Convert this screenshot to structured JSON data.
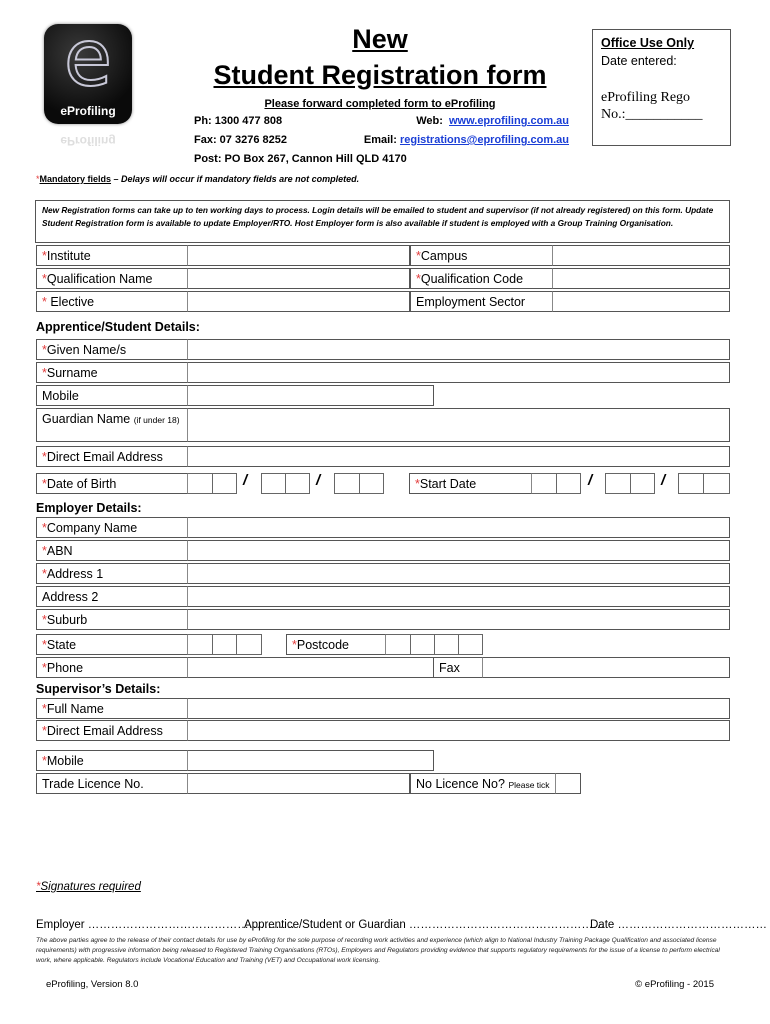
{
  "header": {
    "logo_text": "eProfiling",
    "title_line1": "New",
    "title_line2": "Student Registration form",
    "subtitle": "Please forward completed form to eProfiling",
    "phone": "Ph: 1300 477 808",
    "fax": "Fax: 07 3276 8252",
    "post": "Post: PO Box 267, Cannon Hill QLD 4170",
    "web_label": "Web:",
    "web_link": "www.eprofiling.com.au",
    "email_label": "Email:",
    "email_link": "registrations@eprofiling.com.au"
  },
  "office_use": {
    "title": "Office Use Only",
    "date_entered": "Date entered:",
    "rego_line1": "eProfiling Rego",
    "rego_line2": "No.:___________"
  },
  "mandatory_note": {
    "star": "*",
    "label": "Mandatory fields",
    "text": " – Delays will occur if mandatory fields are not completed."
  },
  "info_box": "New Registration forms can take up to ten working days to process. Login details will be emailed to student and supervisor (if not already registered) on this form. Update Student Registration form is available to update Employer/RTO. Host Employer form is also available if student is employed with a Group Training Organisation.",
  "course": {
    "institute": "Institute",
    "campus": "Campus",
    "qualification_name": "Qualification Name",
    "qualification_code": "Qualification Code",
    "elective": " Elective",
    "employment_sector": "Employment Sector"
  },
  "student": {
    "section_title": "Apprentice/Student Details:",
    "given_names": "Given Name/s",
    "surname": "Surname",
    "mobile": "Mobile",
    "guardian_name": "Guardian Name",
    "guardian_note": "(if under 18)",
    "email": "Direct Email Address",
    "dob": "Date of Birth",
    "start_date": "Start Date",
    "slash": "/"
  },
  "employer": {
    "section_title": "Employer Details:",
    "company_name": "Company Name",
    "abn": "ABN",
    "address1": "Address 1",
    "address2": "Address 2",
    "suburb": "Suburb",
    "state": "State",
    "postcode": "Postcode",
    "phone": "Phone",
    "fax": "Fax"
  },
  "supervisor": {
    "section_title": "Supervisor’s Details:",
    "full_name": "Full Name",
    "email": "Direct Email Address",
    "mobile": "Mobile",
    "trade_licence": "Trade Licence No.",
    "no_licence": "No Licence No?",
    "please_tick": "Please tick"
  },
  "signatures": {
    "required": "Signatures required",
    "employer": "Employer ………………………………………………",
    "student": "Apprentice/Student or Guardian   ……………………………………………",
    "date": "Date …………………………………"
  },
  "disclaimer": "The above parties agree to the release of their contact details for use by eProfiling for the sole purpose of recording work activities and experience (which align to National Industry Training Package Qualification and associated license requirements) with progressive information being released to Registered Training Organisations (RTOs), Employers and Regulators providing evidence that supports regulatory requirements for the issue of a license to perform electrical work, where applicable. Regulators include Vocational Education and Training (VET) and Occupational work licensing.",
  "footer": {
    "version": "eProfiling, Version  8.0",
    "copyright": "©  eProfiling - 2015"
  },
  "colors": {
    "required_star": "#e23a3a",
    "link": "#1a3ed6"
  }
}
